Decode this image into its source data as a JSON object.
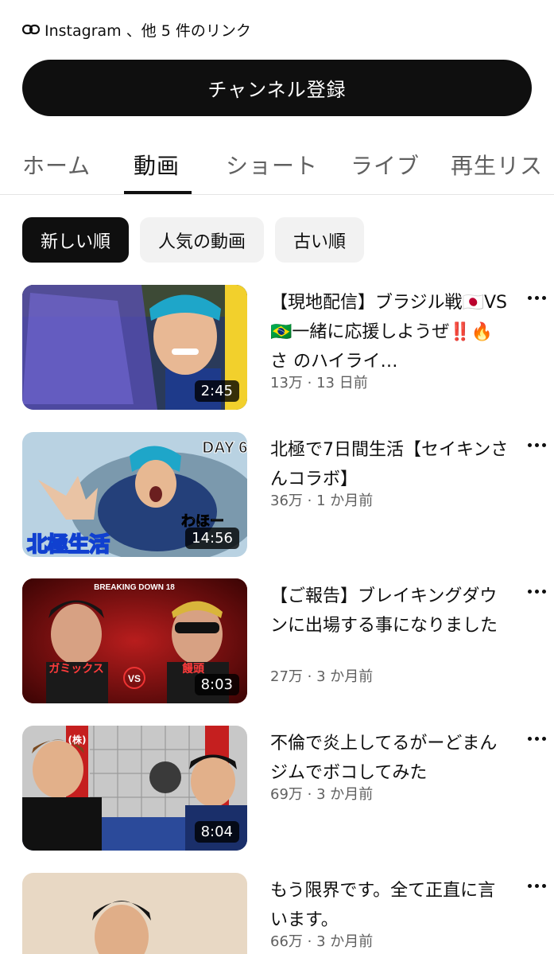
{
  "channel": {
    "links_text": "Instagram 、他 5 件のリンク",
    "subscribe_label": "チャンネル登録"
  },
  "tabs": [
    {
      "label": "ホーム",
      "active": false
    },
    {
      "label": "動画",
      "active": true
    },
    {
      "label": "ショート",
      "active": false
    },
    {
      "label": "ライブ",
      "active": false
    },
    {
      "label": "再生リス",
      "active": false
    }
  ],
  "chips": [
    {
      "label": "新しい順",
      "selected": true
    },
    {
      "label": "人気の動画",
      "selected": false
    },
    {
      "label": "古い順",
      "selected": false
    }
  ],
  "videos": [
    {
      "title": "【現地配信】ブラジル戦🇯🇵VS🇧🇷一緒に応援しようぜ‼️🔥さ のハイライ…",
      "meta": "13万 · 13 日前",
      "duration": "2:45",
      "thumb_text": ""
    },
    {
      "title": "北極で7日間生活【セイキンさんコラボ】",
      "meta": "36万 · 1 か月前",
      "duration": "14:56",
      "thumb_text": "北極生活",
      "thumb_badge": "DAY 6",
      "thumb_caption": "わほー"
    },
    {
      "title": "【ご報告】ブレイキングダウンに出場する事になりました",
      "meta": "27万 · 3 か月前",
      "duration": "8:03",
      "thumb_text": "BREAKING DOWN 18",
      "thumb_left": "ガミックス",
      "thumb_right": "饅頭"
    },
    {
      "title": "不倫で炎上してるがーどまんジムでボコしてみた",
      "meta": "69万 · 3 か月前",
      "duration": "8:04",
      "thumb_text": "(株)"
    },
    {
      "title": "もう限界です。全て正直に言います。",
      "meta": "66万 · 3 か月前",
      "duration": "",
      "thumb_text": ""
    }
  ]
}
